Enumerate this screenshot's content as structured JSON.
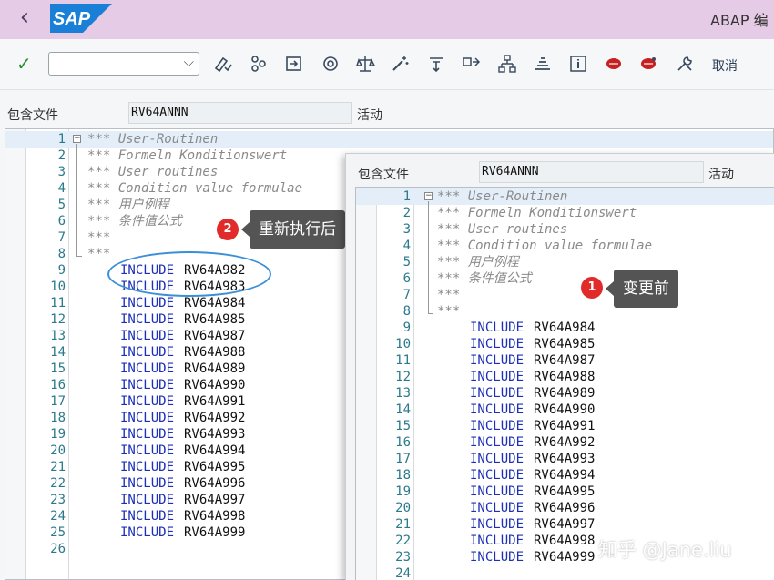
{
  "titlebar": {
    "app_title": "ABAP 编"
  },
  "toolbar": {
    "cancel_label": "取消"
  },
  "main": {
    "include_label": "包含文件",
    "include_value": "RV64ANNN",
    "status": "活动",
    "lines": [
      {
        "n": "1",
        "t": "*** User-Routinen",
        "k": "c"
      },
      {
        "n": "2",
        "t": "*** Formeln Konditionswert",
        "k": "c"
      },
      {
        "n": "3",
        "t": "*** User routines",
        "k": "c"
      },
      {
        "n": "4",
        "t": "*** Condition value formulae",
        "k": "c"
      },
      {
        "n": "5",
        "t": "*** 用户例程",
        "k": "c"
      },
      {
        "n": "6",
        "t": "*** 条件值公式",
        "k": "c"
      },
      {
        "n": "7",
        "t": "***",
        "k": "c"
      },
      {
        "n": "8",
        "t": "***",
        "k": "c"
      },
      {
        "n": "9",
        "kw": "INCLUDE",
        "id": "RV64A982"
      },
      {
        "n": "10",
        "kw": "INCLUDE",
        "id": "RV64A983"
      },
      {
        "n": "11",
        "kw": "INCLUDE",
        "id": "RV64A984"
      },
      {
        "n": "12",
        "kw": "INCLUDE",
        "id": "RV64A985"
      },
      {
        "n": "13",
        "kw": "INCLUDE",
        "id": "RV64A987"
      },
      {
        "n": "14",
        "kw": "INCLUDE",
        "id": "RV64A988"
      },
      {
        "n": "15",
        "kw": "INCLUDE",
        "id": "RV64A989"
      },
      {
        "n": "16",
        "kw": "INCLUDE",
        "id": "RV64A990"
      },
      {
        "n": "17",
        "kw": "INCLUDE",
        "id": "RV64A991"
      },
      {
        "n": "18",
        "kw": "INCLUDE",
        "id": "RV64A992"
      },
      {
        "n": "19",
        "kw": "INCLUDE",
        "id": "RV64A993"
      },
      {
        "n": "20",
        "kw": "INCLUDE",
        "id": "RV64A994"
      },
      {
        "n": "21",
        "kw": "INCLUDE",
        "id": "RV64A995"
      },
      {
        "n": "22",
        "kw": "INCLUDE",
        "id": "RV64A996"
      },
      {
        "n": "23",
        "kw": "INCLUDE",
        "id": "RV64A997"
      },
      {
        "n": "24",
        "kw": "INCLUDE",
        "id": "RV64A998"
      },
      {
        "n": "25",
        "kw": "INCLUDE",
        "id": "RV64A999"
      },
      {
        "n": "26"
      }
    ]
  },
  "overlay": {
    "include_label": "包含文件",
    "include_value": "RV64ANNN",
    "status": "活动",
    "lines": [
      {
        "n": "1",
        "t": "*** User-Routinen",
        "k": "c"
      },
      {
        "n": "2",
        "t": "*** Formeln Konditionswert",
        "k": "c"
      },
      {
        "n": "3",
        "t": "*** User routines",
        "k": "c"
      },
      {
        "n": "4",
        "t": "*** Condition value formulae",
        "k": "c"
      },
      {
        "n": "5",
        "t": "*** 用户例程",
        "k": "c"
      },
      {
        "n": "6",
        "t": "*** 条件值公式",
        "k": "c"
      },
      {
        "n": "7",
        "t": "***",
        "k": "c"
      },
      {
        "n": "8",
        "t": "***",
        "k": "c"
      },
      {
        "n": "9",
        "kw": "INCLUDE",
        "id": "RV64A984"
      },
      {
        "n": "10",
        "kw": "INCLUDE",
        "id": "RV64A985"
      },
      {
        "n": "11",
        "kw": "INCLUDE",
        "id": "RV64A987"
      },
      {
        "n": "12",
        "kw": "INCLUDE",
        "id": "RV64A988"
      },
      {
        "n": "13",
        "kw": "INCLUDE",
        "id": "RV64A989"
      },
      {
        "n": "14",
        "kw": "INCLUDE",
        "id": "RV64A990"
      },
      {
        "n": "15",
        "kw": "INCLUDE",
        "id": "RV64A991"
      },
      {
        "n": "16",
        "kw": "INCLUDE",
        "id": "RV64A992"
      },
      {
        "n": "17",
        "kw": "INCLUDE",
        "id": "RV64A993"
      },
      {
        "n": "18",
        "kw": "INCLUDE",
        "id": "RV64A994"
      },
      {
        "n": "19",
        "kw": "INCLUDE",
        "id": "RV64A995"
      },
      {
        "n": "20",
        "kw": "INCLUDE",
        "id": "RV64A996"
      },
      {
        "n": "21",
        "kw": "INCLUDE",
        "id": "RV64A997"
      },
      {
        "n": "22",
        "kw": "INCLUDE",
        "id": "RV64A998"
      },
      {
        "n": "23",
        "kw": "INCLUDE",
        "id": "RV64A999"
      },
      {
        "n": "24"
      }
    ]
  },
  "callouts": {
    "after": {
      "badge": "2",
      "text": "重新执行后"
    },
    "before": {
      "badge": "1",
      "text": "变更前"
    }
  },
  "watermark": "知乎 @Jane.liu",
  "colors": {
    "titlebar": "#e6cbe6",
    "sap_blue": "#1a7fd6",
    "keyword": "#1c2fb8",
    "comment": "#8a8a8a",
    "line_number": "#2b7a8c",
    "badge": "#e12b2b",
    "highlight_ellipse": "#3b8fd6"
  }
}
